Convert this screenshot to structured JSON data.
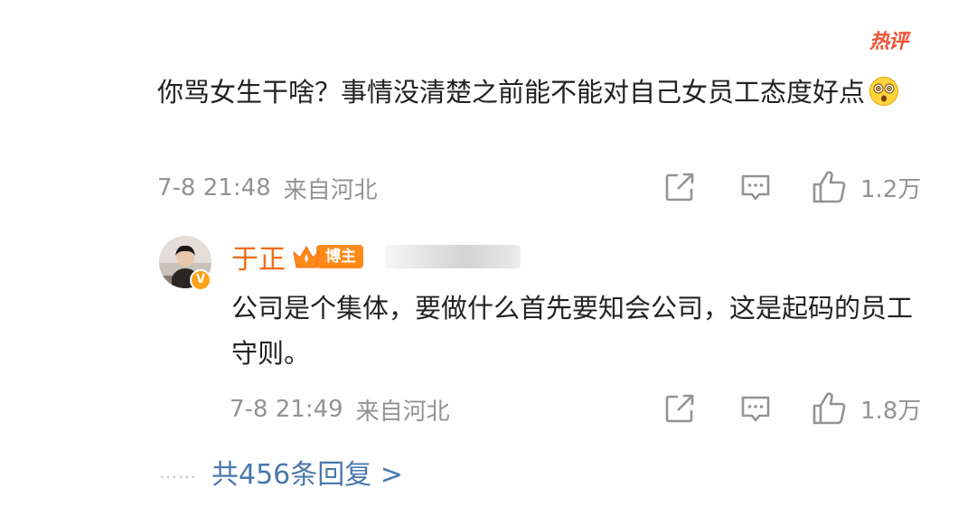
{
  "badge": {
    "label": "热评"
  },
  "comment": {
    "text": "你骂女生干啥？事情没清楚之前能不能对自己女员工态度好点",
    "emoji": "dizzy-face-emoji",
    "time": "7-8 21:48",
    "location": "来自河北",
    "likes": "1.2万"
  },
  "reply": {
    "author": "于正",
    "role_tag": "博主",
    "text": "公司是个集体，要做什么首先要知会公司，这是起码的员工守则。",
    "time": "7-8 21:49",
    "location": "来自河北",
    "likes": "1.8万"
  },
  "more": {
    "dots": "……",
    "label": "共456条回复 >"
  },
  "colors": {
    "accent_orange": "#f06b12",
    "hot_red": "#f25236",
    "link_blue": "#4978ad",
    "meta_gray": "#939393"
  }
}
